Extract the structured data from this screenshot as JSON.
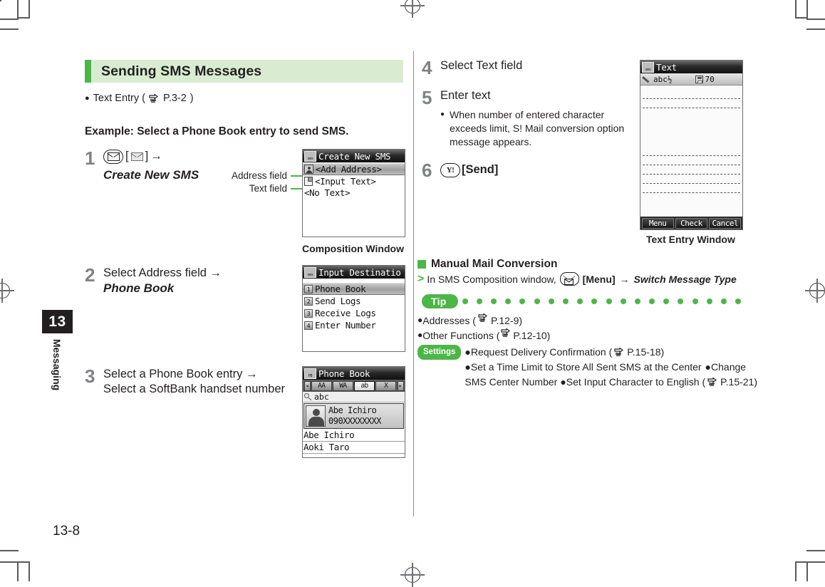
{
  "page": {
    "number": "13-8",
    "chapter_number": "13",
    "chapter_name": "Messaging"
  },
  "left_column": {
    "section_title": "Sending SMS Messages",
    "reference_bullet": "Text Entry (",
    "reference_page": "P.3-2",
    "reference_close": ")",
    "example_line": "Example: Select a Phone Book entry to send SMS.",
    "steps": [
      {
        "num": "1",
        "key_bracket_open": "[",
        "key_bracket_close": "]",
        "arrow": "→",
        "line2": "Create New SMS"
      },
      {
        "num": "2",
        "line1": "Select Address field →",
        "line2": "Phone Book"
      },
      {
        "num": "3",
        "line1": "Select a Phone Book entry →",
        "line2": "Select a SoftBank handset number"
      }
    ],
    "callouts": {
      "address_field": "Address field",
      "text_field": "Text field"
    }
  },
  "right_column": {
    "steps": [
      {
        "num": "4",
        "line1": "Select Text field"
      },
      {
        "num": "5",
        "line1": "Enter text",
        "sub_bullet": "When number of entered character exceeds limit, S! Mail conversion option message appears."
      },
      {
        "num": "6",
        "key_label": "Y!",
        "line1": "[Send]"
      }
    ],
    "subsection": {
      "heading": "Manual Mail Conversion",
      "line_prefix": "In SMS Composition window,",
      "menu_label": "[Menu]",
      "arrow": "→",
      "action": "Switch Message Type"
    },
    "tip": {
      "badge": "Tip",
      "items": [
        {
          "text": "Addresses (",
          "ref": "P.12-9",
          "close": ")"
        },
        {
          "text": "Other Functions (",
          "ref": "P.12-10",
          "close": ")"
        }
      ],
      "settings_badge": "Settings",
      "settings_items": [
        {
          "text": "Request Delivery Confirmation (",
          "ref": "P.15-18",
          "close": ")"
        },
        {
          "text": "Set a Time Limit to Store All Sent SMS at the Center"
        },
        {
          "text": "Change SMS Center Number"
        },
        {
          "text": "Set Input Character to English (",
          "ref": "P.15-21",
          "close": ")"
        }
      ]
    }
  },
  "screens": {
    "composition": {
      "caption": "Composition Window",
      "title": "Create New SMS",
      "title_icon": "sms-envelope-icon",
      "rows": [
        {
          "label": "<Add Address>",
          "icon": "person-icon",
          "selected": true
        },
        {
          "label": "<Input Text>",
          "icon": "document-icon",
          "selected": false
        },
        {
          "label": "<No Text>",
          "icon": "none",
          "selected": false
        }
      ]
    },
    "destination": {
      "title": "Input Destinatio",
      "title_icon": "sms-envelope-icon",
      "rows": [
        {
          "num": "1",
          "label": "Phone Book",
          "selected": true
        },
        {
          "num": "2",
          "label": "Send Logs",
          "selected": false
        },
        {
          "num": "3",
          "label": "Receive Logs",
          "selected": false
        },
        {
          "num": "4",
          "label": "Enter Number",
          "selected": false
        }
      ]
    },
    "phonebook": {
      "title": "Phone Book",
      "title_icon": "phonebook-icon",
      "tabs": [
        {
          "label": "◂",
          "type": "arrow"
        },
        {
          "label": "AA",
          "selected": false
        },
        {
          "label": "WA",
          "selected": false
        },
        {
          "label": "ab",
          "selected": true
        },
        {
          "label": "X",
          "selected": false
        },
        {
          "label": "▸",
          "type": "arrow"
        }
      ],
      "search_value": "abc",
      "contact": {
        "name": "Abe Ichiro",
        "number": "090XXXXXXXX"
      },
      "list": [
        "Abe Ichiro",
        "Aoki Taro"
      ]
    },
    "text_entry": {
      "caption": "Text Entry Window",
      "title": "Text",
      "title_icon": "sms-envelope-icon",
      "status_mode": "abc½",
      "status_count": "70",
      "softkeys": [
        "Menu",
        "Check",
        "Cancel"
      ]
    }
  },
  "colors": {
    "accent_green": "#4cb648",
    "heading_bg": "#d9ecd2",
    "step_number_gray": "#808285",
    "text": "#231f20"
  }
}
